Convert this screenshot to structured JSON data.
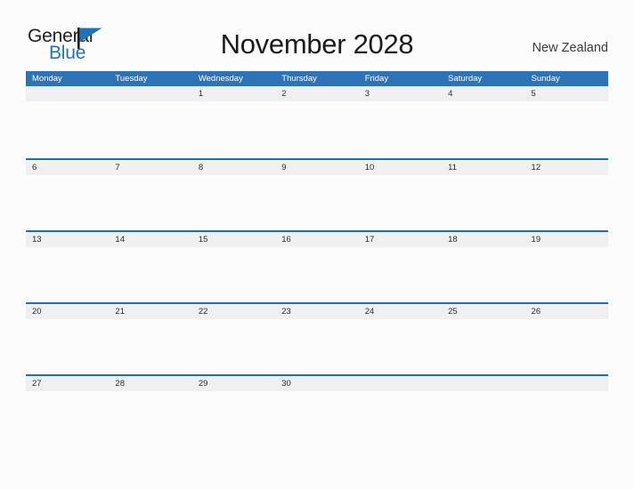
{
  "brand": {
    "word_one": "General",
    "word_two": "Blue",
    "flag_icon": "blue-triangle-flag-icon",
    "color_dark": "#231f20",
    "color_blue": "#1f73b8"
  },
  "header": {
    "title": "November 2028",
    "region": "New Zealand"
  },
  "calendar": {
    "accent_color": "#2e72b8",
    "rule_color": "#1f6fb5",
    "band_color": "#f0f0f0",
    "weekdays": [
      "Monday",
      "Tuesday",
      "Wednesday",
      "Thursday",
      "Friday",
      "Saturday",
      "Sunday"
    ],
    "weeks": [
      {
        "has_rule": false,
        "days": [
          "",
          "",
          "1",
          "2",
          "3",
          "4",
          "5"
        ]
      },
      {
        "has_rule": true,
        "days": [
          "6",
          "7",
          "8",
          "9",
          "10",
          "11",
          "12"
        ]
      },
      {
        "has_rule": true,
        "days": [
          "13",
          "14",
          "15",
          "16",
          "17",
          "18",
          "19"
        ]
      },
      {
        "has_rule": true,
        "days": [
          "20",
          "21",
          "22",
          "23",
          "24",
          "25",
          "26"
        ]
      },
      {
        "has_rule": true,
        "days": [
          "27",
          "28",
          "29",
          "30",
          "",
          "",
          ""
        ]
      }
    ]
  }
}
